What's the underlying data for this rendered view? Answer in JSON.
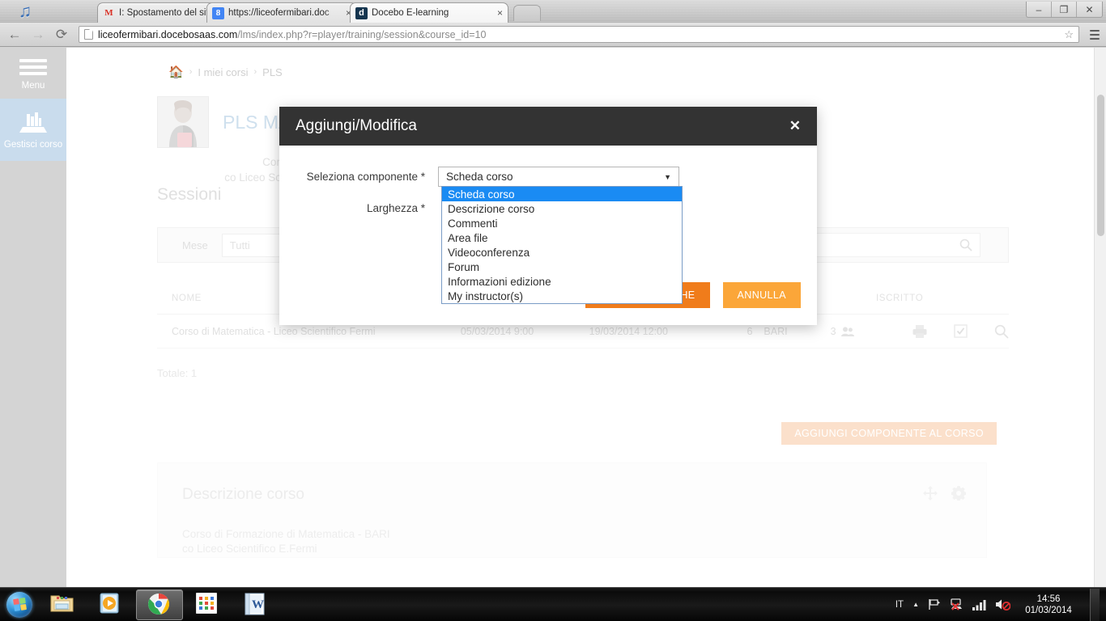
{
  "browser": {
    "tabs": [
      {
        "title": "I: Spostamento del sito de",
        "favicon": "gmail-icon",
        "active": false
      },
      {
        "title": "https://liceofermibari.doc",
        "favicon": "google-icon",
        "active": false
      },
      {
        "title": "Docebo E-learning",
        "favicon": "docebo-icon",
        "active": true
      }
    ],
    "tab_close_label": "×",
    "nav": {
      "back": "←",
      "forward": "→",
      "reload": "⟳"
    },
    "url_host": "liceofermibari.docebosaas.com",
    "url_path": "/lms/index.php?r=player/training/session&course_id=10",
    "star": "☆",
    "window_controls": {
      "minimize": "–",
      "restore": "❐",
      "close": "✕"
    }
  },
  "sidebar": {
    "items": [
      {
        "label": "Menu",
        "icon": "hamburger-icon"
      },
      {
        "label": "Gestisci corso",
        "icon": "books-icon"
      }
    ]
  },
  "breadcrumb": {
    "home_icon": "home-icon",
    "separator": "›",
    "items": [
      "I miei corsi",
      "PLS"
    ]
  },
  "course": {
    "title": "PLS MA",
    "subtitle_line1": "Corso di Fo",
    "subtitle_line2": "co Liceo Scientifico E.Ferm",
    "avatar_alt": "course-avatar"
  },
  "sessions": {
    "heading": "Sessioni",
    "filter_label": "Mese",
    "filter_value": "Tutti",
    "search_placeholder": "",
    "search_icon": "search-icon",
    "columns": [
      "NOME",
      "",
      "",
      "",
      "",
      "ISCRITTO",
      ""
    ],
    "rows": [
      {
        "nome": "Corso di Matematica - Liceo Scientifico Fermi",
        "data_inizio": "05/03/2014 9:00",
        "data_fine": "19/03/2014 12:00",
        "numero": "6",
        "luogo": "BARI",
        "iscritto": "3",
        "actions": [
          "print-icon",
          "checkbox-icon",
          "search-icon"
        ]
      }
    ],
    "total_label": "Totale: 1"
  },
  "add_component_button": "AGGIUNGI COMPONENTE AL CORSO",
  "description_panel": {
    "title": "Descrizione corso",
    "line1": "Corso di Formazione di Matematica - BARI",
    "line2": "co Liceo Scientifico E.Fermi",
    "tools": [
      "move-icon",
      "gear-icon"
    ]
  },
  "modal": {
    "title": "Aggiungi/Modifica",
    "close_label": "✕",
    "fields": [
      {
        "label": "Seleziona componente *",
        "value": "Scheda corso",
        "caret": "▼"
      },
      {
        "label": "Larghezza *",
        "value": ""
      }
    ],
    "dropdown_options": [
      "Scheda corso",
      "Descrizione corso",
      "Commenti",
      "Area file",
      "Videoconferenza",
      "Forum",
      "Informazioni edizione",
      "My instructor(s)"
    ],
    "dropdown_selected_index": 0,
    "save_label": "SALVA MODIFICHE",
    "cancel_label": "ANNULLA"
  },
  "taskbar": {
    "start_label": "start-orb",
    "items": [
      {
        "name": "explorer-icon",
        "active": false
      },
      {
        "name": "media-player-icon",
        "active": false
      },
      {
        "name": "chrome-icon",
        "active": true
      },
      {
        "name": "apps-grid-icon",
        "active": false
      },
      {
        "name": "word-icon",
        "active": false
      }
    ],
    "tray": {
      "language": "IT",
      "show_hidden": "▲",
      "flag_icon": "flag-icon",
      "network_icon": "network-error-icon",
      "signal_icon": "signal-bars-icon",
      "volume_icon": "volume-muted-icon",
      "time": "14:56",
      "date": "01/03/2014"
    }
  },
  "colors": {
    "accent_orange": "#f07c1b",
    "accent_orange_light": "#fba639",
    "modal_header": "#333333",
    "dropdown_highlight": "#1a8bf3",
    "sidebar_active": "#c9dced"
  }
}
